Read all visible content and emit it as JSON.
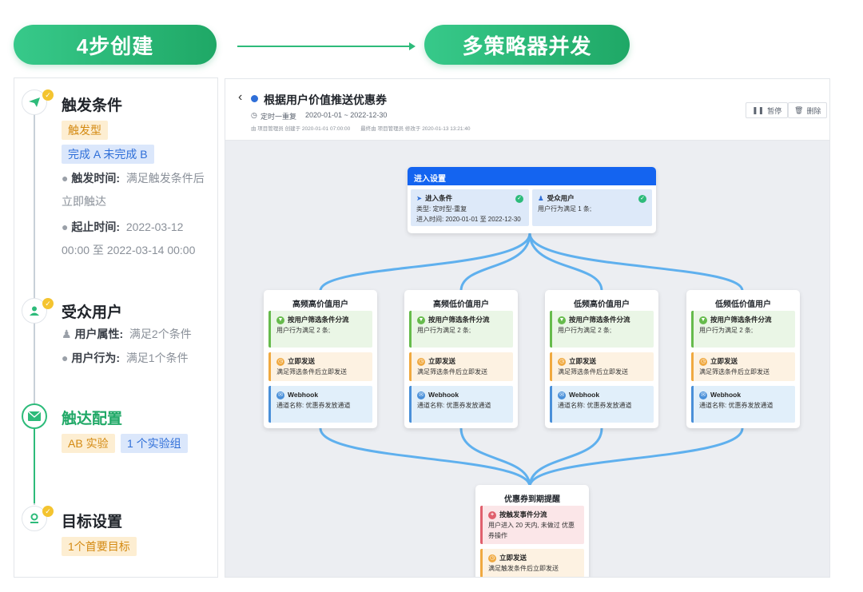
{
  "header": {
    "left_pill": "4步创建",
    "right_pill": "多策略器并发"
  },
  "steps": [
    {
      "title": "触发条件",
      "tags": [
        "触发型",
        "完成 A 未完成 B"
      ],
      "lines": [
        {
          "label": "触发时间:",
          "value": "满足触发条件后立即触达"
        },
        {
          "label": "起止时间:",
          "value": "2022-03-12 00:00 至 2022-03-14 00:00"
        }
      ]
    },
    {
      "title": "受众用户",
      "lines": [
        {
          "label": "用户属性:",
          "value": "满足2个条件"
        },
        {
          "label": "用户行为:",
          "value": "满足1个条件"
        }
      ]
    },
    {
      "title": "触达配置",
      "tags": [
        "AB 实验",
        "1 个实验组"
      ]
    },
    {
      "title": "目标设置",
      "tags": [
        "1个首要目标"
      ]
    }
  ],
  "detail": {
    "back": "‹",
    "title": "根据用户价值推送优惠券",
    "schedule": "定时一重复",
    "date_range": "2020-01-01 ~ 2022-12-30",
    "meta": "由 项目管理员 创建于 2020-01-01 07:00:00　　最终由 项目管理员 修改于 2020-01-13 13:21:40",
    "pause": "暂停",
    "delete": "删除"
  },
  "entry": {
    "header": "进入设置",
    "cond_title": "进入条件",
    "cond_type": "类型: 定时型-重复",
    "cond_time": "进入时间: 2020-01-01 至 2022-12-30",
    "aud_title": "受众用户",
    "aud_desc": "用户行为满足 1 条;"
  },
  "branches": [
    {
      "title": "高频高价值用户",
      "split": "按用户筛选条件分流",
      "split_desc": "用户行为满足 2 条;",
      "send": "立即发送",
      "send_desc": "满足筛选条件后立即发送",
      "hook": "Webhook",
      "hook_desc": "通道名称: 优惠券发放通道"
    },
    {
      "title": "高频低价值用户",
      "split": "按用户筛选条件分流",
      "split_desc": "用户行为满足 2 条;",
      "send": "立即发送",
      "send_desc": "满足筛选条件后立即发送",
      "hook": "Webhook",
      "hook_desc": "通道名称: 优惠券发放通道"
    },
    {
      "title": "低频高价值用户",
      "split": "按用户筛选条件分流",
      "split_desc": "用户行为满足 2 条;",
      "send": "立即发送",
      "send_desc": "满足筛选条件后立即发送",
      "hook": "Webhook",
      "hook_desc": "通道名称: 优惠券发放通道"
    },
    {
      "title": "低频低价值用户",
      "split": "按用户筛选条件分流",
      "split_desc": "用户行为满足 2 条;",
      "send": "立即发送",
      "send_desc": "满足筛选条件后立即发送",
      "hook": "Webhook",
      "hook_desc": "通道名称: 优惠券发放通道"
    }
  ],
  "final": {
    "title": "优惠券到期提醒",
    "event": "按触发事件分流",
    "event_desc": "用户进入 20 天内, 未做过 优惠券操作",
    "send": "立即发送",
    "send_desc": "满足触发条件后立即发送"
  }
}
